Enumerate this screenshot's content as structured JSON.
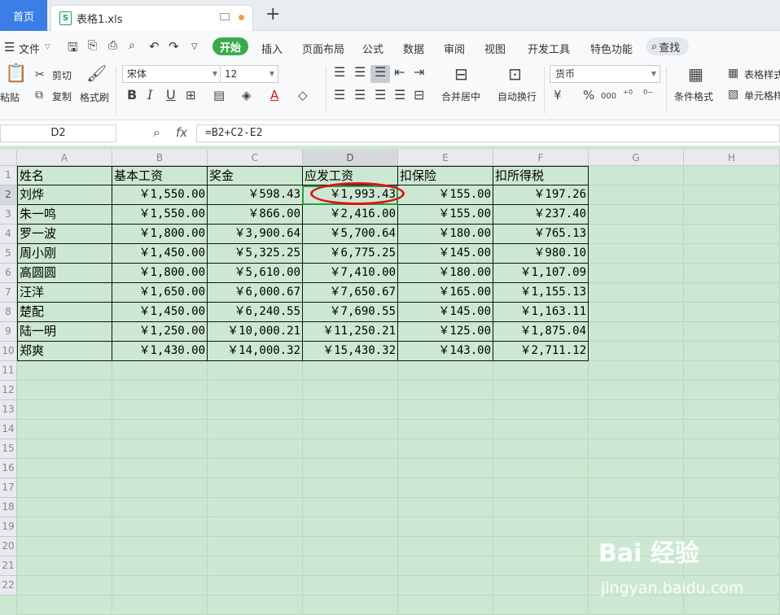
{
  "tabs": {
    "home": "首页",
    "file": "表格1.xls",
    "file_icon": "S",
    "add": "+"
  },
  "menu": {
    "file": "文件",
    "items": [
      "开始",
      "插入",
      "页面布局",
      "公式",
      "数据",
      "审阅",
      "视图",
      "开发工具",
      "特色功能"
    ],
    "search": "查找"
  },
  "ribbon": {
    "paste": "粘贴",
    "cut": "剪切",
    "copy": "复制",
    "format_painter": "格式刷",
    "font": "宋体",
    "size": "12",
    "merge": "合并居中",
    "wrap": "自动换行",
    "number_format": "货币",
    "yen": "¥",
    "pct": "%",
    "thousands": "000",
    "cond_format": "条件格式",
    "table_style": "表格样式",
    "cell_style": "单元格样式"
  },
  "formula_bar": {
    "name_box": "D2",
    "fx": "fx",
    "formula": "=B2+C2-E2"
  },
  "columns": [
    "A",
    "B",
    "C",
    "D",
    "E",
    "F",
    "G",
    "H"
  ],
  "rows": [
    "1",
    "2",
    "3",
    "4",
    "5",
    "6",
    "7",
    "8",
    "9",
    "10",
    "11",
    "12",
    "13",
    "14",
    "15",
    "16",
    "17",
    "18",
    "19",
    "20",
    "21",
    "22"
  ],
  "sheet": {
    "headers": [
      "姓名",
      "基本工资",
      "奖金",
      "应发工资",
      "扣保险",
      "扣所得税"
    ],
    "data": [
      [
        "刘烨",
        "￥1,550.00",
        "￥598.43",
        "￥1,993.43",
        "￥155.00",
        "￥197.26"
      ],
      [
        "朱一鸣",
        "￥1,550.00",
        "￥866.00",
        "￥2,416.00",
        "￥155.00",
        "￥237.40"
      ],
      [
        "罗一波",
        "￥1,800.00",
        "￥3,900.64",
        "￥5,700.64",
        "￥180.00",
        "￥765.13"
      ],
      [
        "周小刚",
        "￥1,450.00",
        "￥5,325.25",
        "￥6,775.25",
        "￥145.00",
        "￥980.10"
      ],
      [
        "高圆圆",
        "￥1,800.00",
        "￥5,610.00",
        "￥7,410.00",
        "￥180.00",
        "￥1,107.09"
      ],
      [
        "汪洋",
        "￥1,650.00",
        "￥6,000.67",
        "￥7,650.67",
        "￥165.00",
        "￥1,155.13"
      ],
      [
        "楚配",
        "￥1,450.00",
        "￥6,240.55",
        "￥7,690.55",
        "￥145.00",
        "￥1,163.11"
      ],
      [
        "陆一明",
        "￥1,250.00",
        "￥10,000.21",
        "￥11,250.21",
        "￥125.00",
        "￥1,875.04"
      ],
      [
        "郑爽",
        "￥1,430.00",
        "￥14,000.32",
        "￥15,430.32",
        "￥143.00",
        "￥2,711.12"
      ]
    ]
  },
  "watermark": {
    "brand": "Bai 经验",
    "url": "jingyan.baidu.com"
  },
  "colors": {
    "accent": "#3aab4c",
    "tab": "#3c7ee8",
    "grid": "#cde8d2",
    "highlight": "#d9141b"
  }
}
